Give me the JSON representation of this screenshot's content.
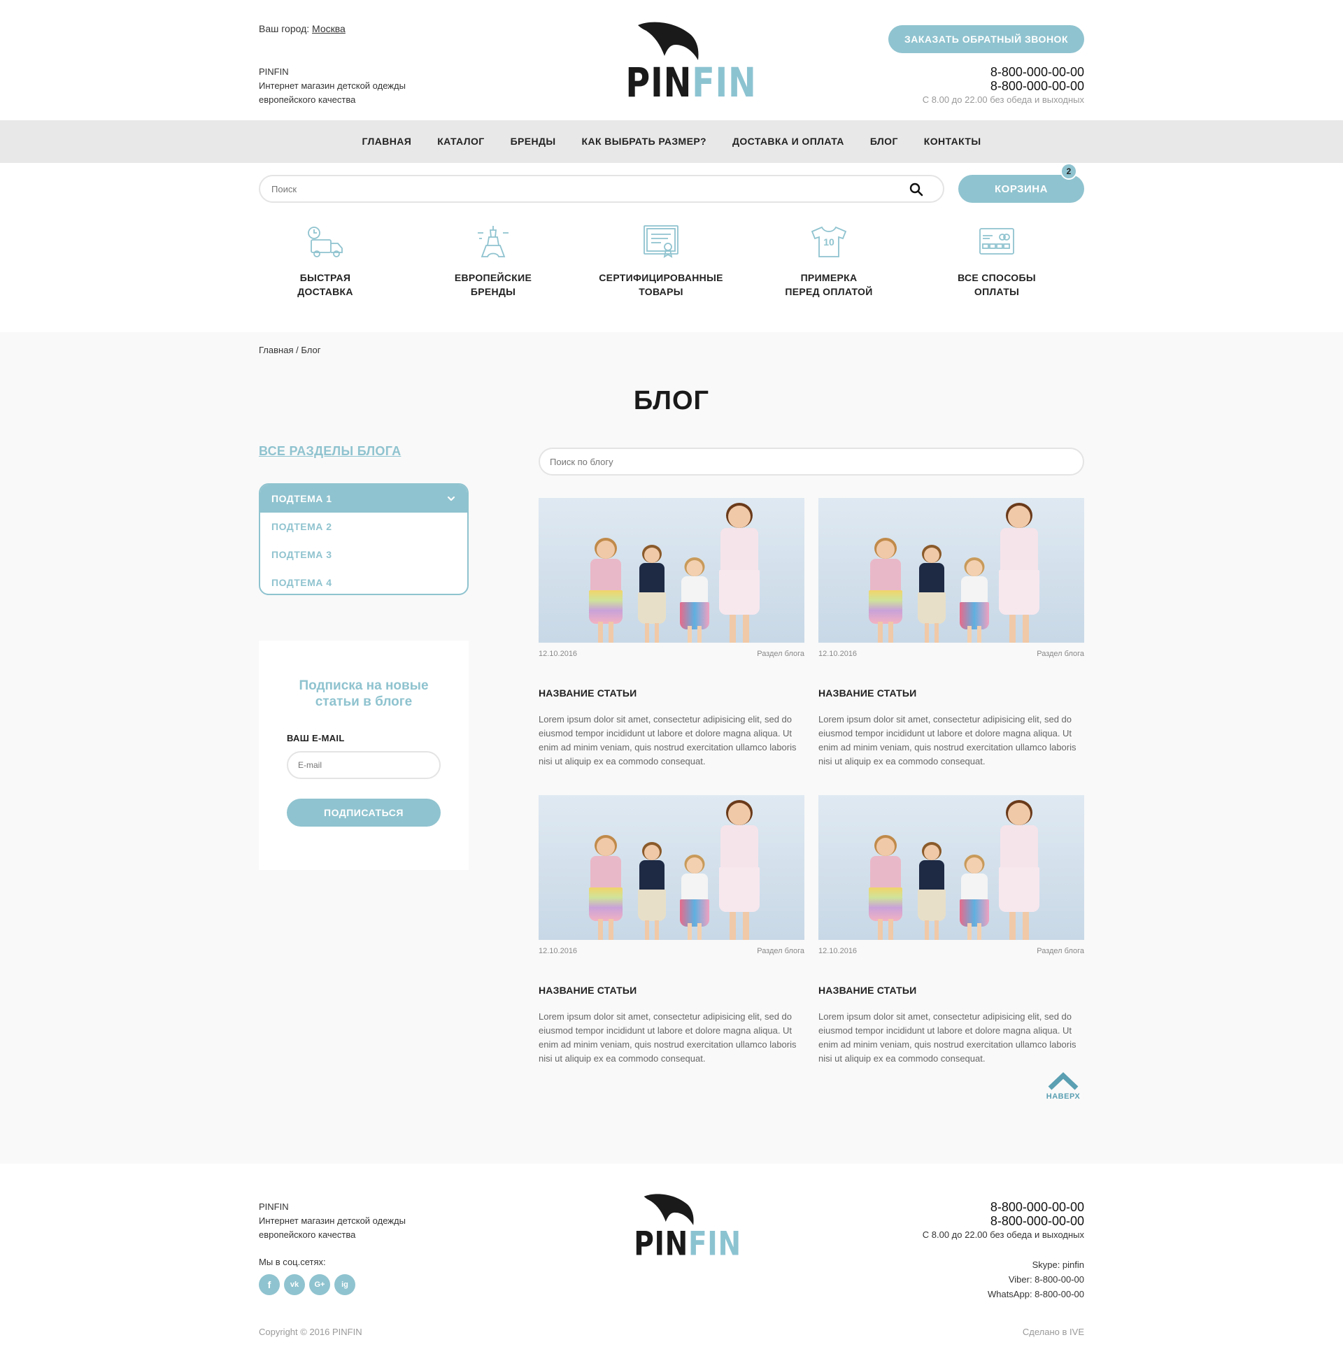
{
  "header": {
    "city_label": "Ваш город:",
    "city_value": "Москва",
    "shop_name": "PINFIN",
    "shop_desc_line1": "Интернет магазин детской одежды",
    "shop_desc_line2": "европейского качества",
    "logo_part1": "PIN",
    "logo_part2": "FIN",
    "callback_label": "ЗАКАЗАТЬ ОБРАТНЫЙ ЗВОНОК",
    "phone1": "8-800-000-00-00",
    "phone2": "8-800-000-00-00",
    "hours": "С 8.00 до 22.00 без обеда и выходных"
  },
  "nav": {
    "items": [
      "ГЛАВНАЯ",
      "КАТАЛОГ",
      "БРЕНДЫ",
      "КАК ВЫБРАТЬ РАЗМЕР?",
      "ДОСТАВКА И ОПЛАТА",
      "БЛОГ",
      "КОНТАКТЫ"
    ]
  },
  "search": {
    "placeholder": "Поиск",
    "cart_label": "КОРЗИНА",
    "cart_count": "2"
  },
  "features": [
    {
      "line1": "БЫСТРАЯ",
      "line2": "ДОСТАВКА",
      "icon": "delivery-truck-icon"
    },
    {
      "line1": "ЕВРОПЕЙСКИЕ",
      "line2": "БРЕНДЫ",
      "icon": "eiffel-tower-icon"
    },
    {
      "line1": "СЕРТИФИЦИРОВАННЫЕ",
      "line2": "ТОВАРЫ",
      "icon": "certificate-icon"
    },
    {
      "line1": "ПРИМЕРКА",
      "line2": "ПЕРЕД ОПЛАТОЙ",
      "icon": "tshirt-icon"
    },
    {
      "line1": "ВСЕ СПОСОБЫ",
      "line2": "ОПЛАТЫ",
      "icon": "payment-card-icon"
    }
  ],
  "breadcrumb": {
    "home": "Главная",
    "separator": "/",
    "current": "Блог"
  },
  "page_title": "БЛОГ",
  "sidebar": {
    "all_sections": "ВСЕ РАЗДЕЛЫ БЛОГА",
    "topics": [
      "ПОДТЕМА 1",
      "ПОДТЕМА 2",
      "ПОДТЕМА 3",
      "ПОДТЕМА 4"
    ],
    "subscribe_title_line1": "Подписка на новые",
    "subscribe_title_line2": "статьи в блоге",
    "email_label": "ВАШ E-MAIL",
    "email_placeholder": "E-mail",
    "subscribe_button": "ПОДПИСАТЬСЯ"
  },
  "blog": {
    "search_placeholder": "Поиск по блогу",
    "articles": [
      {
        "date": "12.10.2016",
        "section": "Раздел блога",
        "title": "НАЗВАНИЕ СТАТЬИ",
        "excerpt": "Lorem ipsum dolor sit amet, consectetur adipisicing elit, sed do eiusmod tempor incididunt ut labore et dolore magna aliqua. Ut enim ad minim veniam, quis nostrud exercitation ullamco laboris nisi ut aliquip ex ea commodo consequat."
      },
      {
        "date": "12.10.2016",
        "section": "Раздел блога",
        "title": "НАЗВАНИЕ СТАТЬИ",
        "excerpt": "Lorem ipsum dolor sit amet, consectetur adipisicing elit, sed do eiusmod tempor incididunt ut labore et dolore magna aliqua. Ut enim ad minim veniam, quis nostrud exercitation ullamco laboris nisi ut aliquip ex ea commodo consequat."
      },
      {
        "date": "12.10.2016",
        "section": "Раздел блога",
        "title": "НАЗВАНИЕ СТАТЬИ",
        "excerpt": "Lorem ipsum dolor sit amet, consectetur adipisicing elit, sed do eiusmod tempor incididunt ut labore et dolore magna aliqua. Ut enim ad minim veniam, quis nostrud exercitation ullamco laboris nisi ut aliquip ex ea commodo consequat."
      },
      {
        "date": "12.10.2016",
        "section": "Раздел блога",
        "title": "НАЗВАНИЕ СТАТЬИ",
        "excerpt": "Lorem ipsum dolor sit amet, consectetur adipisicing elit, sed do eiusmod tempor incididunt ut labore et dolore magna aliqua. Ut enim ad minim veniam, quis nostrud exercitation ullamco laboris nisi ut aliquip ex ea commodo consequat."
      }
    ],
    "to_top_label": "НАВЕРХ"
  },
  "footer": {
    "shop_name": "PINFIN",
    "shop_desc_line1": "Интернет магазин детской одежды",
    "shop_desc_line2": "европейского качества",
    "social_label": "Мы в соц.сетях:",
    "socials": [
      "f",
      "vk",
      "G+",
      "ig"
    ],
    "phone1": "8-800-000-00-00",
    "phone2": "8-800-000-00-00",
    "hours": "С 8.00 до 22.00 без обеда и выходных",
    "skype": "Skype: pinfin",
    "viber": "Viber: 8-800-00-00",
    "whatsapp": "WhatsApp: 8-800-00-00",
    "copyright": "Copyright © 2016 PINFIN",
    "made_by": "Сделано в IVE"
  },
  "colors": {
    "accent": "#8fc3cf",
    "nav_bg": "#e8e8e8",
    "main_bg": "#f9f9f9"
  }
}
